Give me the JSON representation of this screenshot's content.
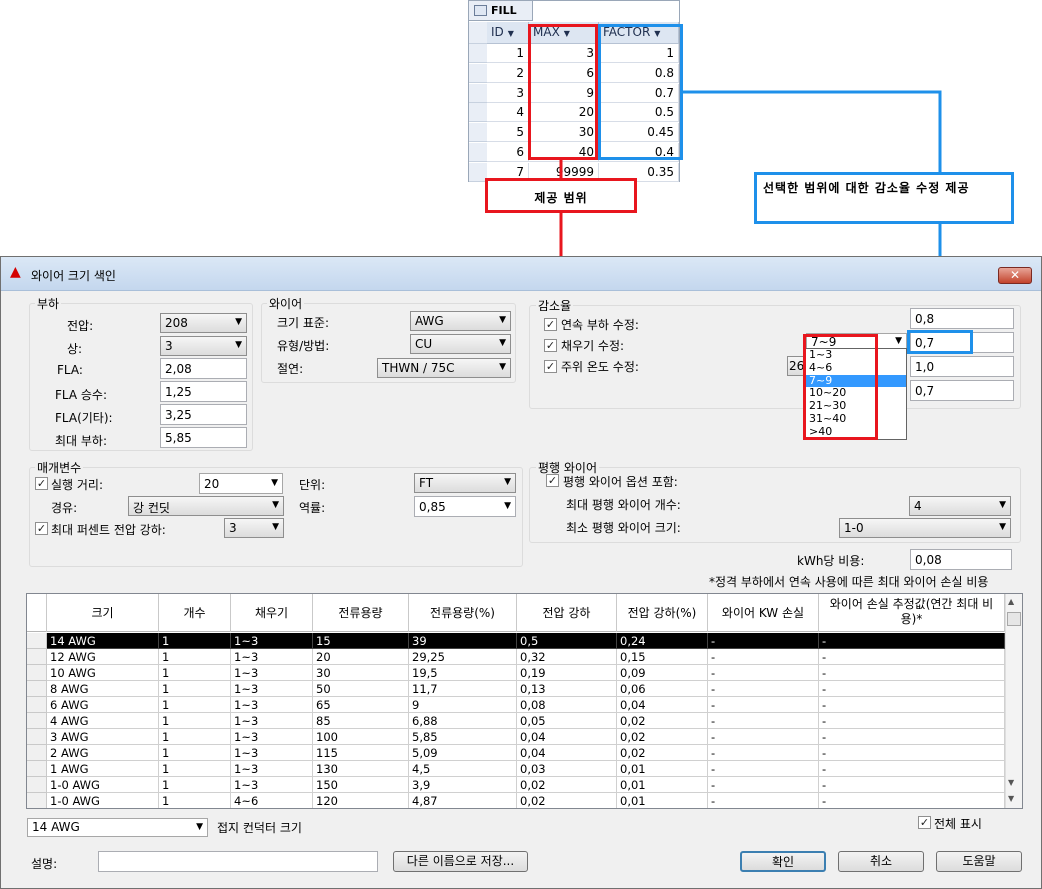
{
  "fill_table": {
    "tab_name": "FILL",
    "headers": [
      "ID",
      "MAX",
      "FACTOR"
    ],
    "rows": [
      [
        "1",
        "3",
        "1"
      ],
      [
        "2",
        "6",
        "0.8"
      ],
      [
        "3",
        "9",
        "0.7"
      ],
      [
        "4",
        "20",
        "0.5"
      ],
      [
        "5",
        "30",
        "0.45"
      ],
      [
        "6",
        "40",
        "0.4"
      ],
      [
        "7",
        "99999",
        "0.35"
      ]
    ]
  },
  "annotations": {
    "range_label": "제공 범위",
    "factor_label": "선택한 범위에 대한 감소율 수정 제공"
  },
  "dialog": {
    "title": "와이어 크기 색인",
    "close": "✕",
    "load": {
      "group": "부하",
      "voltage_label": "전압:",
      "voltage": "208",
      "phase_label": "상:",
      "phase": "3",
      "fla_label": "FLA:",
      "fla": "2,08",
      "fla_mult_label": "FLA 승수:",
      "fla_mult": "1,25",
      "fla_other_label": "FLA(기타):",
      "fla_other": "3,25",
      "max_load_label": "최대 부하:",
      "max_load": "5,85"
    },
    "wire": {
      "group": "와이어",
      "size_std_label": "크기 표준:",
      "size_std": "AWG",
      "type_label": "유형/방법:",
      "type": "CU",
      "insulation_label": "절연:",
      "insulation": "THWN / 75C"
    },
    "derate": {
      "group": "감소율",
      "continuous_label": "연속 부하 수정:",
      "continuous_value": "0,8",
      "fill_label": "채우기 수정:",
      "fill_select": "7~9",
      "fill_value": "0,7",
      "ambient_label": "주위 온도 수정:",
      "ambient_select": "26",
      "ambient_value": "1,0",
      "extra_value": "0,7",
      "fill_options": [
        "1~3",
        "4~6",
        "7~9",
        "10~20",
        "21~30",
        "31~40",
        ">40"
      ],
      "fill_selected_index": 2
    },
    "params": {
      "group": "매개변수",
      "run_label": "실행 거리:",
      "run": "20",
      "unit_label": "단위:",
      "unit": "FT",
      "path_label": "경유:",
      "path": "강 컨딧",
      "pf_label": "역률:",
      "pf": "0,85",
      "vdrop_label": "최대 퍼센트 전압 강하:",
      "vdrop": "3"
    },
    "parallel": {
      "group": "평행 와이어",
      "include_label": "평행 와이어 옵션 포함:",
      "max_count_label": "최대 평행 와이어 개수:",
      "max_count": "4",
      "min_size_label": "최소 평행 와이어 크기:",
      "min_size": "1-0"
    },
    "kwh_label": "kWh당 비용:",
    "kwh_value": "0,08",
    "note": "*정격 부하에서 연속 사용에 따른 최대 와이어 손실 비용",
    "grid": {
      "headers": [
        "크기",
        "개수",
        "채우기",
        "전류용량",
        "전류용량(%)",
        "전압 강하",
        "전압 강하(%)",
        "와이어 KW 손실",
        "와이어 손실 추정값(연간 최대 비용)*"
      ],
      "rows": [
        [
          "14 AWG",
          "1",
          "1~3",
          "15",
          "39",
          "0,5",
          "0,24",
          "-",
          "-"
        ],
        [
          "12 AWG",
          "1",
          "1~3",
          "20",
          "29,25",
          "0,32",
          "0,15",
          "-",
          "-"
        ],
        [
          "10 AWG",
          "1",
          "1~3",
          "30",
          "19,5",
          "0,19",
          "0,09",
          "-",
          "-"
        ],
        [
          "8 AWG",
          "1",
          "1~3",
          "50",
          "11,7",
          "0,13",
          "0,06",
          "-",
          "-"
        ],
        [
          "6 AWG",
          "1",
          "1~3",
          "65",
          "9",
          "0,08",
          "0,04",
          "-",
          "-"
        ],
        [
          "4 AWG",
          "1",
          "1~3",
          "85",
          "6,88",
          "0,05",
          "0,02",
          "-",
          "-"
        ],
        [
          "3 AWG",
          "1",
          "1~3",
          "100",
          "5,85",
          "0,04",
          "0,02",
          "-",
          "-"
        ],
        [
          "2 AWG",
          "1",
          "1~3",
          "115",
          "5,09",
          "0,04",
          "0,02",
          "-",
          "-"
        ],
        [
          "1 AWG",
          "1",
          "1~3",
          "130",
          "4,5",
          "0,03",
          "0,01",
          "-",
          "-"
        ],
        [
          "1-0 AWG",
          "1",
          "1~3",
          "150",
          "3,9",
          "0,02",
          "0,01",
          "-",
          "-"
        ],
        [
          "1-0 AWG",
          "1",
          "4~6",
          "120",
          "4,87",
          "0,02",
          "0,01",
          "-",
          "-"
        ]
      ],
      "selected_row": 0
    },
    "ground_size": "14 AWG",
    "ground_label": "접지 컨덕터 크기",
    "show_all_label": "전체 표시",
    "desc_label": "설명:",
    "desc_value": "",
    "save_as": "다른 이름으로 저장...",
    "ok": "확인",
    "cancel": "취소",
    "help": "도움말"
  }
}
